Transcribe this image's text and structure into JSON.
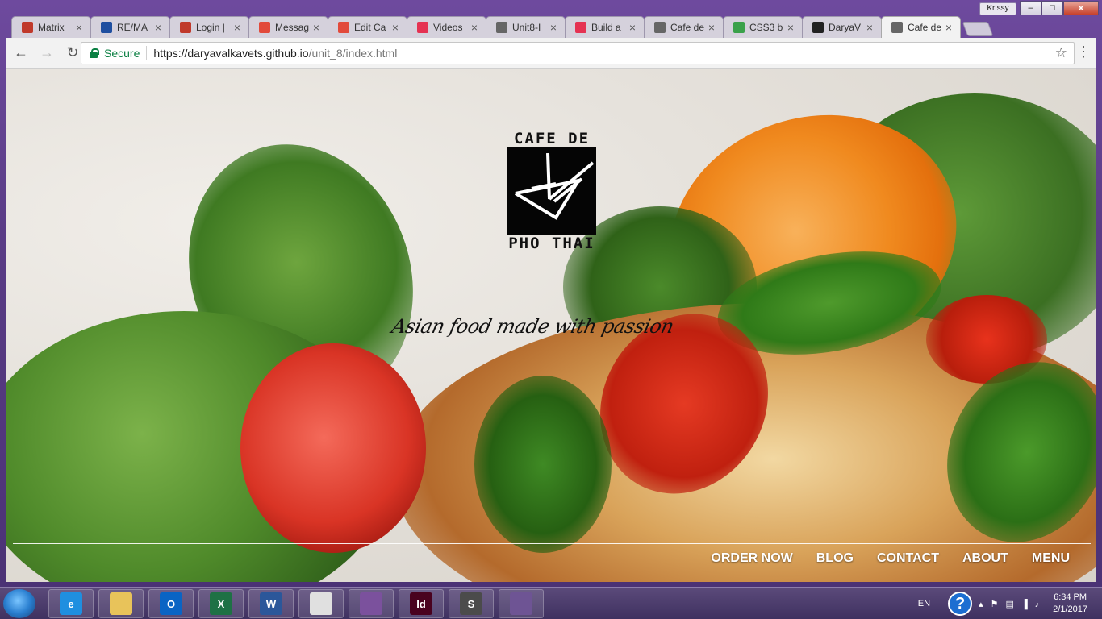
{
  "window": {
    "user_badge": "Krissy",
    "controls": {
      "minimize": "–",
      "maximize": "□",
      "close": "✕"
    }
  },
  "tabs": [
    {
      "label": "Matrix",
      "icon": "matrix-icon",
      "color": "#c0392b"
    },
    {
      "label": "RE/MA",
      "icon": "remax-icon",
      "color": "#1f4fa0"
    },
    {
      "label": "Login |",
      "icon": "x-logo-icon",
      "color": "#c0392b"
    },
    {
      "label": "Messag",
      "icon": "chat-icon",
      "color": "#e24a3b"
    },
    {
      "label": "Edit Ca",
      "icon": "chat-icon",
      "color": "#e24a3b"
    },
    {
      "label": "Videos",
      "icon": "ca-icon",
      "color": "#e53252"
    },
    {
      "label": "Unit8-I",
      "icon": "document-icon",
      "color": "#666666"
    },
    {
      "label": "Build a",
      "icon": "ca-icon",
      "color": "#e53252"
    },
    {
      "label": "Cafe de",
      "icon": "document-icon",
      "color": "#666666"
    },
    {
      "label": "CSS3 b",
      "icon": "css3-icon",
      "color": "#3aa14a"
    },
    {
      "label": "DaryaV",
      "icon": "github-icon",
      "color": "#222222"
    },
    {
      "label": "Cafe de",
      "icon": "document-icon",
      "color": "#666666",
      "active": true
    }
  ],
  "toolbar": {
    "back": "←",
    "forward": "→",
    "reload": "↻",
    "secure_label": "Secure",
    "url_host": "https://daryavalkavets.github.io",
    "url_path": "/unit_8/index.html",
    "star": "☆",
    "menu": "⋮"
  },
  "page": {
    "logo": {
      "top": "CAFE DE",
      "bottom": "PHO THAI"
    },
    "tagline": "Asian food made with passion",
    "nav": [
      "ORDER NOW",
      "BLOG",
      "CONTACT",
      "ABOUT",
      "MENU"
    ]
  },
  "taskbar": {
    "apps": [
      {
        "name": "internet-explorer-icon",
        "label": "e",
        "color": "#1f8fe0"
      },
      {
        "name": "file-explorer-icon",
        "label": "",
        "color": "#e8c35a"
      },
      {
        "name": "outlook-icon",
        "label": "O",
        "color": "#0a64c4"
      },
      {
        "name": "excel-icon",
        "label": "X",
        "color": "#1e7145"
      },
      {
        "name": "word-icon",
        "label": "W",
        "color": "#2b579a"
      },
      {
        "name": "chrome-icon",
        "label": "",
        "color": "#e0e0e0"
      },
      {
        "name": "viber-icon",
        "label": "",
        "color": "#7b519d"
      },
      {
        "name": "indesign-icon",
        "label": "Id",
        "color": "#49021f"
      },
      {
        "name": "sublime-text-icon",
        "label": "S",
        "color": "#4b4b4b"
      },
      {
        "name": "github-desktop-icon",
        "label": "",
        "color": "#6e5494"
      }
    ],
    "lang": "EN",
    "help": "?",
    "tray_icons": [
      "▴",
      "⚑",
      "▤",
      "▐",
      "♪"
    ],
    "time": "6:34 PM",
    "date": "2/1/2017"
  }
}
